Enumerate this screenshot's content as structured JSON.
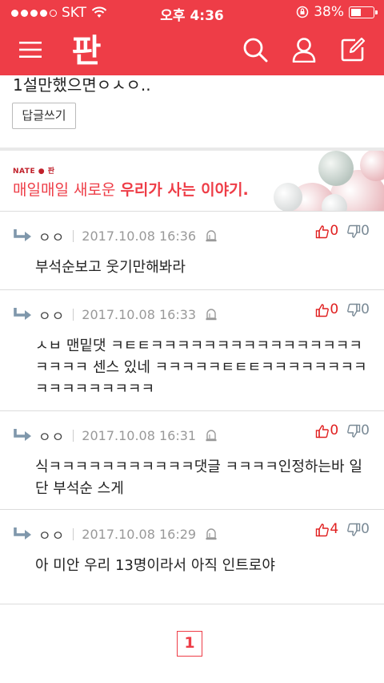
{
  "status_bar": {
    "carrier": "SKT",
    "time": "오후 4:36",
    "battery": "38%",
    "battery_level": 0.38
  },
  "header": {
    "logo": "판",
    "icons": [
      "menu-icon",
      "search-icon",
      "user-icon",
      "write-icon"
    ],
    "accent_color": "#ee3d47"
  },
  "prev_reply": {
    "text": "1설만했으면ㅇㅅㅇ..",
    "reply_button": "답글쓰기"
  },
  "banner": {
    "brand": "NATE ● 판",
    "text_plain": "매일매일 새로운 ",
    "text_bold": "우리가 사는 이야기."
  },
  "comments": [
    {
      "name": "ㅇㅇ",
      "date": "2017.10.08 16:36",
      "up": "0",
      "down": "0",
      "body": "부석순보고 웃기만해봐라"
    },
    {
      "name": "ㅇㅇ",
      "date": "2017.10.08 16:33",
      "up": "0",
      "down": "0",
      "body": "ㅅㅂ 맨밑댓 ㅋㅌㅌㅋㅋㅋㅋㅋㅋㅋㅋㅋㅋㅋㅋㅋㅋㅋㅋㅋㅋㅋㅋ 센스 있네 ㅋㅋㅋㅋㅋㅌㅌㅌㅋㅋㅋㅋㅋㅋㅋㅋㅋㅋㅋㅋㅋㅋㅋㅋㅋ"
    },
    {
      "name": "ㅇㅇ",
      "date": "2017.10.08 16:31",
      "up": "0",
      "down": "0",
      "body": "식ㅋㅋㅋㅋㅋㅋㅋㅋㅋㅋㅋ댓글 ㅋㅋㅋㅋ인정하는바 일단 부석순 스게"
    },
    {
      "name": "ㅇㅇ",
      "date": "2017.10.08 16:29",
      "up": "4",
      "down": "0",
      "body": "아 미안 우리 13명이라서 아직 인트로야"
    }
  ],
  "pagination": {
    "current": "1"
  }
}
